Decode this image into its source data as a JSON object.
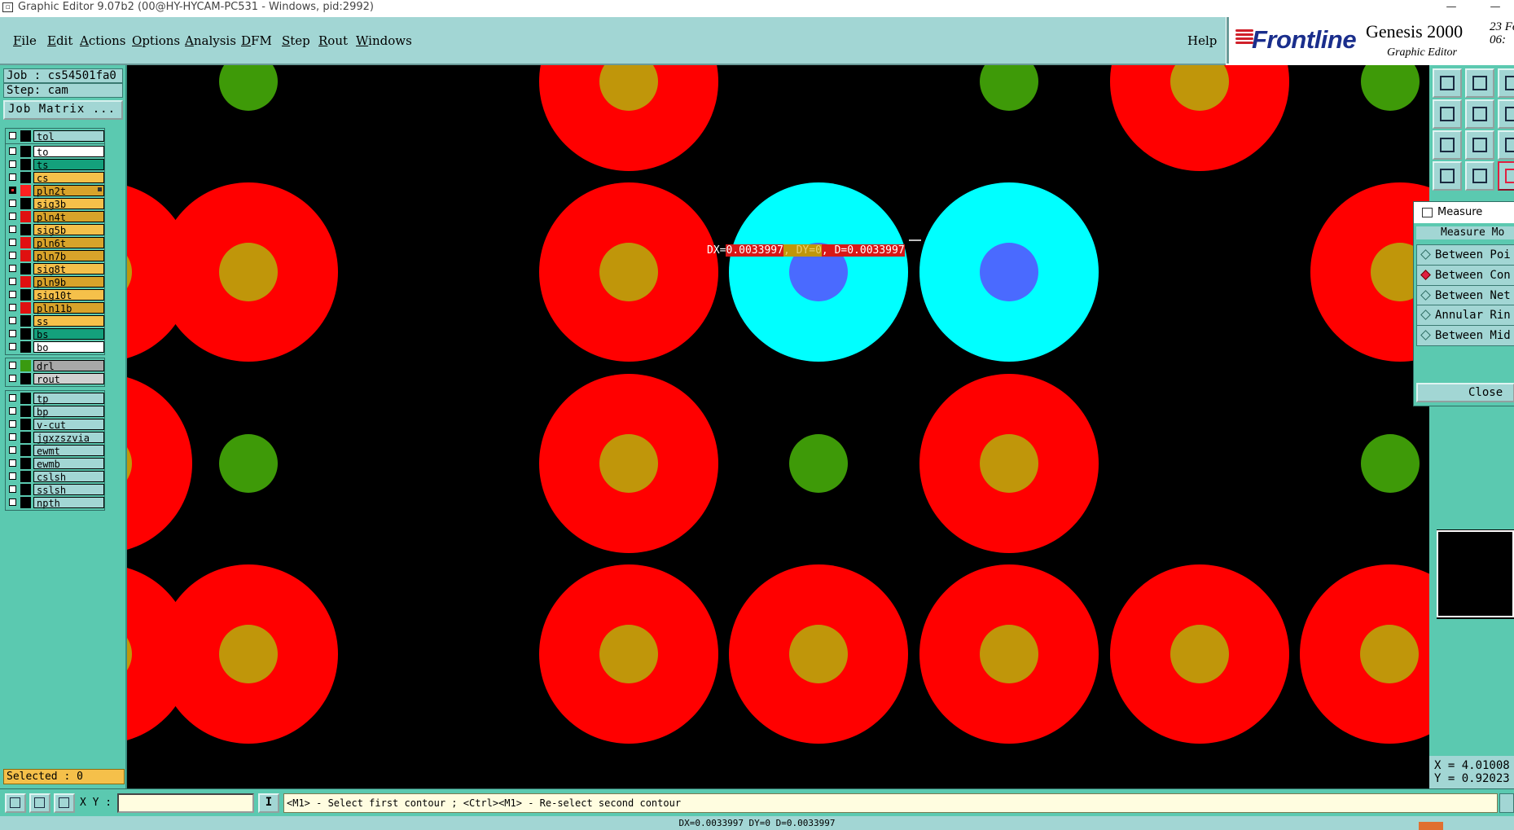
{
  "window": {
    "title": "Graphic Editor 9.07b2 (00@HY-HYCAM-PC531 - Windows, pid:2992)",
    "minimize_glyph": "—",
    "close_glyph": "—"
  },
  "menu": {
    "items": [
      {
        "label": "File",
        "hotkey": "F",
        "rest": "ile"
      },
      {
        "label": "Edit",
        "hotkey": "E",
        "rest": "dit"
      },
      {
        "label": "Actions",
        "hotkey": "A",
        "rest": "ctions"
      },
      {
        "label": "Options",
        "hotkey": "O",
        "rest": "ptions"
      },
      {
        "label": "Analysis",
        "hotkey": "A",
        "rest": "nalysis"
      },
      {
        "label": "DFM",
        "hotkey": "D",
        "rest": "FM"
      },
      {
        "label": "Step",
        "hotkey": "S",
        "rest": "tep"
      },
      {
        "label": "Rout",
        "hotkey": "R",
        "rest": "out"
      },
      {
        "label": "Windows",
        "hotkey": "W",
        "rest": "indows"
      }
    ],
    "help": "Help"
  },
  "brand": {
    "logo": "Frontline",
    "product": "Genesis 2000",
    "subtitle": "Graphic Editor",
    "date_time": "23 Fe\n06:"
  },
  "job": {
    "job_label": "Job : cs54501fa0",
    "step_label": "Step: cam",
    "matrix_button": "Job Matrix ..."
  },
  "layer_groups": [
    {
      "layers": [
        {
          "name": "tol",
          "color": "#a2d6d4",
          "checked": false
        }
      ]
    },
    {
      "layers": [
        {
          "name": "to",
          "color": "#ffffff",
          "checked": false
        },
        {
          "name": "ts",
          "color": "#14a07c",
          "checked": false
        },
        {
          "name": "cs",
          "color": "#f5c04a",
          "checked": false
        },
        {
          "name": "pln2t",
          "color": "#d8a32a",
          "checked": true,
          "swatch": "#ff2020",
          "active": true
        },
        {
          "name": "sig3b",
          "color": "#f5c04a",
          "checked": false
        },
        {
          "name": "pln4t",
          "color": "#d8a32a",
          "checked": false,
          "swatch": "#e01010"
        },
        {
          "name": "sig5b",
          "color": "#f5c04a",
          "checked": false
        },
        {
          "name": "pln6t",
          "color": "#d8a32a",
          "checked": false,
          "swatch": "#e01010"
        },
        {
          "name": "pln7b",
          "color": "#d8a32a",
          "checked": false,
          "swatch": "#e01010"
        },
        {
          "name": "sig8t",
          "color": "#f5c04a",
          "checked": false
        },
        {
          "name": "pln9b",
          "color": "#d8a32a",
          "checked": false,
          "swatch": "#e01010"
        },
        {
          "name": "sig10t",
          "color": "#f5c04a",
          "checked": false
        },
        {
          "name": "pln11b",
          "color": "#d8a32a",
          "checked": false,
          "swatch": "#e01010"
        },
        {
          "name": "ss",
          "color": "#f5c04a",
          "checked": false
        },
        {
          "name": "bs",
          "color": "#14a07c",
          "checked": false
        },
        {
          "name": "bo",
          "color": "#ffffff",
          "checked": false
        }
      ]
    },
    {
      "layers": [
        {
          "name": "drl",
          "color": "#a8a8a8",
          "checked": false,
          "swatch": "#3a9a10"
        },
        {
          "name": "rout",
          "color": "#d0d0d0",
          "checked": false
        }
      ]
    },
    {
      "layers": [
        {
          "name": "tp",
          "color": "#a2d6d4",
          "checked": false
        },
        {
          "name": "bp",
          "color": "#a2d6d4",
          "checked": false
        },
        {
          "name": "v-cut",
          "color": "#a2d6d4",
          "checked": false
        },
        {
          "name": "jgxzszvia",
          "color": "#a2d6d4",
          "checked": false
        },
        {
          "name": "ewmt",
          "color": "#a2d6d4",
          "checked": false
        },
        {
          "name": "ewmb",
          "color": "#a2d6d4",
          "checked": false
        },
        {
          "name": "cslsh",
          "color": "#a2d6d4",
          "checked": false
        },
        {
          "name": "sslsh",
          "color": "#a2d6d4",
          "checked": false
        },
        {
          "name": "npth",
          "color": "#a2d6d4",
          "checked": false
        }
      ]
    }
  ],
  "selected": "Selected : 0",
  "canvas": {
    "colors": {
      "pad": "#ff0000",
      "hole": "#c0960a",
      "drill": "#3e9a08",
      "highlight": "#00ffff",
      "highlight_hole": "#4a6aff",
      "background": "#000000"
    },
    "measure_text": {
      "dx_label": "DX=",
      "dx_value": "0.0033997",
      "dy_label": "DY=0",
      "d_label": "D=0.0033997"
    }
  },
  "measure_popup": {
    "title": "Measure Popup",
    "mode_label": "Measure Mo",
    "options": [
      {
        "label": "Between Poi",
        "selected": false
      },
      {
        "label": "Between Con",
        "selected": true
      },
      {
        "label": "Between Net",
        "selected": false
      },
      {
        "label": "Annular Rin",
        "selected": false
      },
      {
        "label": "Between Mid",
        "selected": false
      }
    ],
    "close": "Close"
  },
  "coords": {
    "x": "X = 4.01008",
    "y": "Y = 0.92023"
  },
  "cmdbar": {
    "xy_label": "X Y :",
    "xy_value": "",
    "info_button": "I",
    "prompt": "<M1> - Select first contour ; <Ctrl><M1> - Re-select second contour"
  },
  "status": {
    "text": "DX=0.0033997 DY=0 D=0.0033997"
  }
}
